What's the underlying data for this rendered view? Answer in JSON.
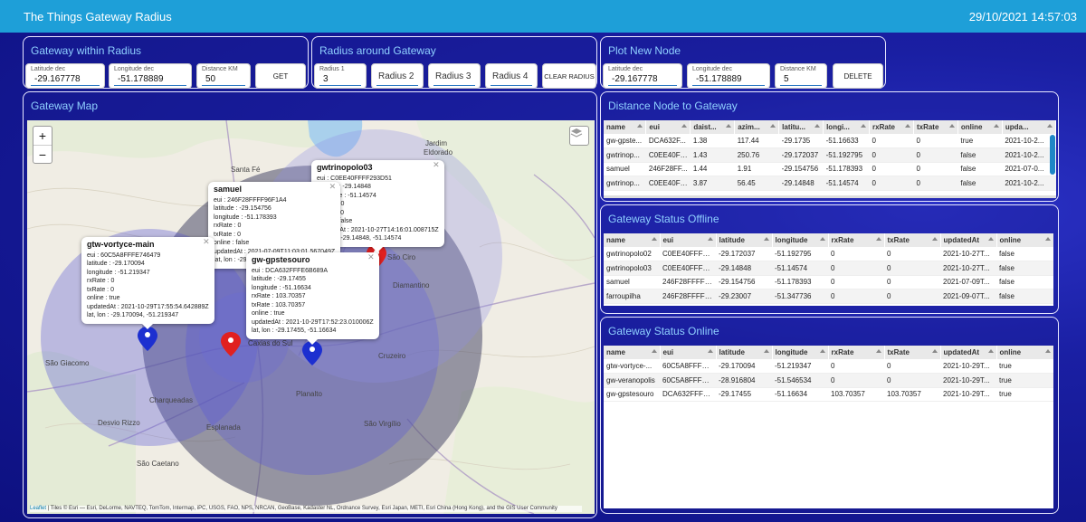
{
  "header": {
    "title": "The Things Gateway Radius",
    "datetime": "29/10/2021 14:57:03"
  },
  "gateway_within_radius": {
    "title": "Gateway within Radius",
    "lat_label": "Latitude dec",
    "lat_value": "-29.167778",
    "lon_label": "Longitude dec",
    "lon_value": "-51.178889",
    "dist_label": "Distance KM",
    "dist_value": "50",
    "get_label": "GET"
  },
  "radius_around_gateway": {
    "title": "Radius around Gateway",
    "r1_label": "Radius 1",
    "r1_value": "3",
    "r2_label": "Radius 2",
    "r3_label": "Radius 3",
    "r4_label": "Radius 4",
    "clear_label": "CLEAR RADIUS"
  },
  "plot_new_node": {
    "title": "Plot New Node",
    "lat_label": "Latitude dec",
    "lat_value": "-29.167778",
    "lon_label": "Longitude dec",
    "lon_value": "-51.178889",
    "dist_label": "Distance KM",
    "dist_value": "5",
    "delete_label": "DELETE"
  },
  "gateway_map": {
    "title": "Gateway Map",
    "zoom_in": "+",
    "zoom_out": "−",
    "attribution_link": "Leaflet",
    "attribution": " | Tiles © Esri — Esri, DeLorme, NAVTEQ, TomTom, Intermap, iPC, USGS, FAO, NPS, NRCAN, GeoBase, Kadaster NL, Ordnance Survey, Esri Japan, METI, Esri China (Hong Kong), and the GIS User Community",
    "place_labels": {
      "jardim": "Jardim",
      "eldorado": "Eldorado",
      "santafe": "Santa Fé",
      "saociro": "São Ciro",
      "diamantino": "Diamantino",
      "saogiacomo": "São Giacomo",
      "charqueadas": "Charqueadas",
      "cruzeiro": "Cruzeiro",
      "planalto": "Planalto",
      "desviorizzo": "Desvio Rizzo",
      "esplanada": "Esplanada",
      "saovirgilio": "São Virgílio",
      "saocaetano": "São Caetano",
      "caxias": "Caxias do Sul"
    },
    "popups": [
      {
        "title": "gwtrinopolo03",
        "lines": [
          "eui : C0EE40FFFF293D51",
          "latitude : -29.14848",
          "longitude : -51.14574",
          "rxRate : 0",
          "txRate : 0",
          "online : false",
          "updatedAt : 2021-10-27T14:16:01.008715Z",
          "lat, lon : -29.14848, -51.14574"
        ]
      },
      {
        "title": "samuel",
        "lines": [
          "eui : 246F28FFFF96F1A4",
          "latitude : -29.154756",
          "longitude : -51.178393",
          "rxRate : 0",
          "txRate : 0",
          "online : false",
          "updatedAt : 2021-07-09T11:03:01.567049Z",
          "lat, lon : -29.154756, -51.178393"
        ]
      },
      {
        "title": "gtw-vortyce-main",
        "lines": [
          "eui : 60C5A8FFFE746479",
          "latitude : -29.170094",
          "longitude : -51.219347",
          "rxRate : 0",
          "txRate : 0",
          "online : true",
          "updatedAt : 2021-10-29T17:55:54.642889Z",
          "lat, lon : -29.170094, -51.219347"
        ]
      },
      {
        "title": "gw-gpstesouro",
        "lines": [
          "eui : DCA632FFFE6B689A",
          "latitude : -29.17455",
          "longitude : -51.16634",
          "rxRate : 103.70357",
          "txRate : 103.70357",
          "online : true",
          "updatedAt : 2021-10-29T17:52:23.010006Z",
          "lat, lon : -29.17455, -51.16634"
        ]
      }
    ]
  },
  "distance_node": {
    "title": "Distance Node to Gateway",
    "columns": [
      "name",
      "eui",
      "daist...",
      "azim...",
      "latitu...",
      "longi...",
      "rxRate",
      "txRate",
      "online",
      "upda..."
    ],
    "rows": [
      [
        "gw-gpste...",
        "DCA632F...",
        "1.38",
        "117.44",
        "-29.1735",
        "-51.16633",
        "0",
        "0",
        "true",
        "2021-10-2..."
      ],
      [
        "gwtrinop...",
        "C0EE40FF...",
        "1.43",
        "250.76",
        "-29.172037",
        "-51.192795",
        "0",
        "0",
        "false",
        "2021-10-2..."
      ],
      [
        "samuel",
        "246F28FF...",
        "1.44",
        "1.91",
        "-29.154756",
        "-51.178393",
        "0",
        "0",
        "false",
        "2021-07-0..."
      ],
      [
        "gwtrinop...",
        "C0EE40FF...",
        "3.87",
        "56.45",
        "-29.14848",
        "-51.14574",
        "0",
        "0",
        "false",
        "2021-10-2..."
      ]
    ]
  },
  "status_offline": {
    "title": "Gateway Status Offline",
    "columns": [
      "name",
      "eui",
      "latitude",
      "longitude",
      "rxRate",
      "txRate",
      "updatedAt",
      "online"
    ],
    "rows": [
      [
        "gwtrinopolo02",
        "C0EE40FFFF2...",
        "-29.172037",
        "-51.192795",
        "0",
        "0",
        "2021-10-27T...",
        "false"
      ],
      [
        "gwtrinopolo03",
        "C0EE40FFFF2...",
        "-29.14848",
        "-51.14574",
        "0",
        "0",
        "2021-10-27T...",
        "false"
      ],
      [
        "samuel",
        "246F28FFFF9...",
        "-29.154756",
        "-51.178393",
        "0",
        "0",
        "2021-07-09T...",
        "false"
      ],
      [
        "farroupilha",
        "246F28FFFF9...",
        "-29.23007",
        "-51.347736",
        "0",
        "0",
        "2021-09-07T...",
        "false"
      ]
    ]
  },
  "status_online": {
    "title": "Gateway Status Online",
    "columns": [
      "name",
      "eui",
      "latitude",
      "longitude",
      "rxRate",
      "txRate",
      "updatedAt",
      "online"
    ],
    "rows": [
      [
        "gtw-vortyce-...",
        "60C5A8FFFE7...",
        "-29.170094",
        "-51.219347",
        "0",
        "0",
        "2021-10-29T...",
        "true"
      ],
      [
        "gw-veranopolis",
        "60C5A8FFFE7...",
        "-28.916804",
        "-51.546534",
        "0",
        "0",
        "2021-10-29T...",
        "true"
      ],
      [
        "gw-gpstesouro",
        "DCA632FFFE6...",
        "-29.17455",
        "-51.16634",
        "103.70357",
        "103.70357",
        "2021-10-29T...",
        "true"
      ]
    ]
  },
  "colors": {
    "topbar": "#1e9fd8",
    "panel_title": "#8fd0ff",
    "marker_online": "#1c2fd0",
    "marker_offline": "#e02020"
  }
}
